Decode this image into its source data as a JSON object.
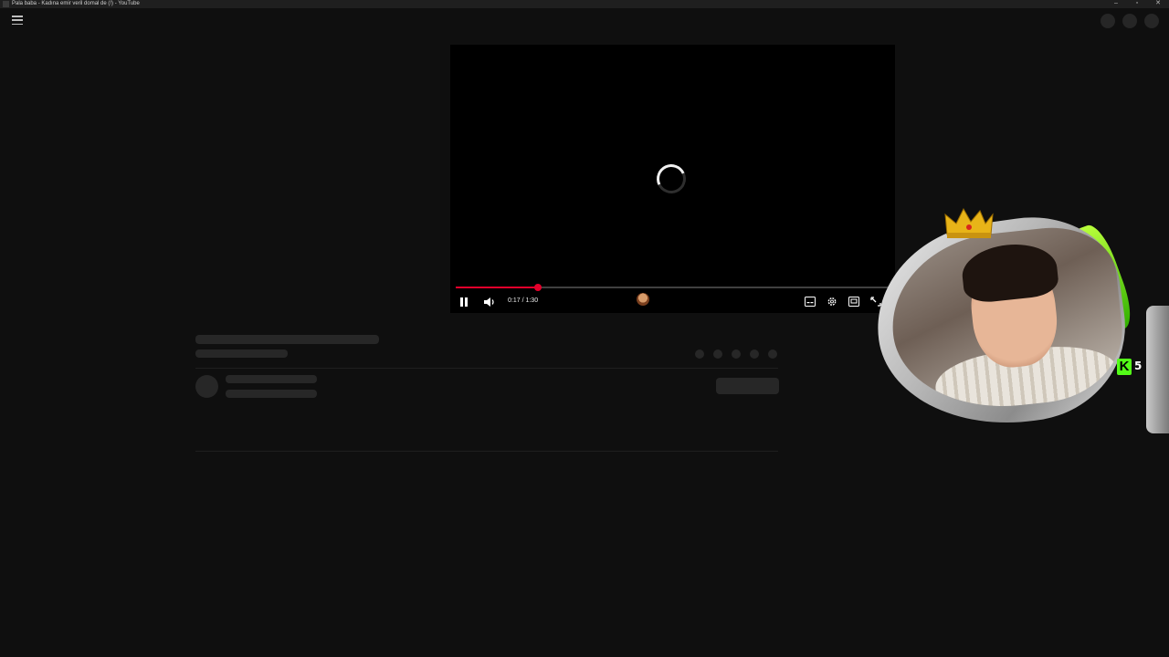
{
  "window": {
    "title": "Pala baba - Kadına emir veril domal de (!) - YouTube",
    "minimize": "–",
    "maximize": "▫",
    "close": "✕"
  },
  "player": {
    "current_time": "0:17",
    "duration": "1:30",
    "time_display": "0:17 / 1:30",
    "progress_fraction": 0.19,
    "state": "buffering"
  },
  "overlay": {
    "badge_letter": "K",
    "badge_count": "5"
  },
  "colors": {
    "accent": "#e4002b",
    "background": "#0f0f0f",
    "kick_green": "#53fc18"
  }
}
